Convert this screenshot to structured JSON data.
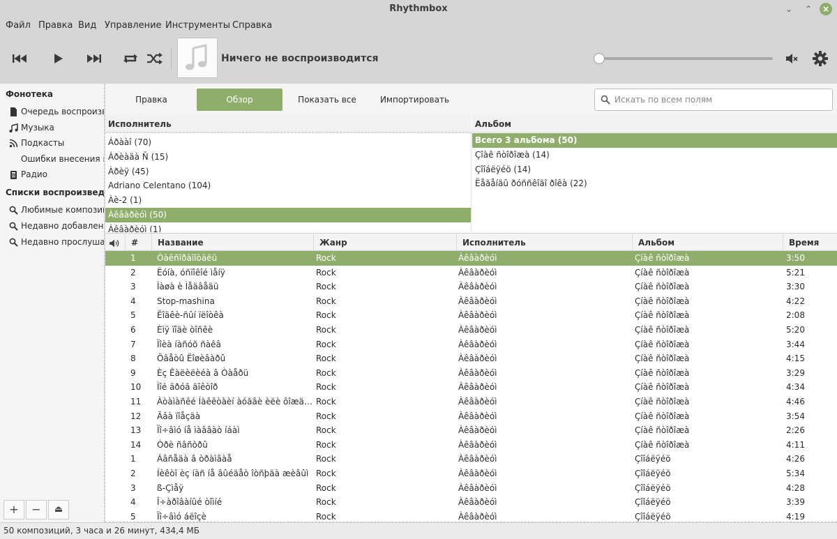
{
  "window": {
    "title": "Rhythmbox"
  },
  "menu": [
    "Файл",
    "Правка",
    "Вид",
    "Управление",
    "Инструменты",
    "Справка"
  ],
  "player": {
    "now_playing": "Ничего не воспроизводится",
    "seek_position": 0
  },
  "sidebar": {
    "library_header": "Фонотека",
    "library_items": [
      {
        "label": "Очередь воспроизведения",
        "icon": "document-icon"
      },
      {
        "label": "Музыка",
        "icon": "music-note-icon"
      },
      {
        "label": "Подкасты",
        "icon": "rss-icon"
      },
      {
        "label": "Ошибки внесения в фонотеку",
        "icon": ""
      },
      {
        "label": "Радио",
        "icon": "radio-icon"
      }
    ],
    "playlists_header": "Списки воспроизведения",
    "playlist_items": [
      {
        "label": "Любимые композиции",
        "icon": "search-icon"
      },
      {
        "label": "Недавно добавленные",
        "icon": "search-icon"
      },
      {
        "label": "Недавно прослушанные",
        "icon": "search-icon"
      }
    ],
    "footer_buttons": [
      "+",
      "−",
      "⏏"
    ]
  },
  "modebar": {
    "buttons": [
      {
        "label": "Правка",
        "active": false
      },
      {
        "label": "Обзор",
        "active": true
      },
      {
        "label": "Показать все",
        "active": false
      },
      {
        "label": "Импортировать",
        "active": false
      }
    ],
    "search_placeholder": "Искать по всем полям"
  },
  "browser": {
    "artist_header": "Исполнитель",
    "album_header": "Альбом",
    "artists": [
      {
        "label": "Áðààî (70)",
        "selected": false
      },
      {
        "label": "Áðèàäà Ñ (15)",
        "selected": false
      },
      {
        "label": "Àðèÿ (45)",
        "selected": false
      },
      {
        "label": "Adriano Celentano (104)",
        "selected": false
      },
      {
        "label": "Àè-2 (1)",
        "selected": false
      },
      {
        "label": "Àêâàðèóì (50)",
        "selected": true
      },
      {
        "label": "Àêâàðèóì (1)",
        "selected": false
      }
    ],
    "albums": [
      {
        "label": "Всего 3 альбома (50)",
        "selected": true
      },
      {
        "label": "Çîàê ñòîðîæà (14)",
        "selected": false
      },
      {
        "label": "Çîîáëÿéö (14)",
        "selected": false
      },
      {
        "label": "Ëåãåíäû ðóññêîãî ðîêà (22)",
        "selected": false
      }
    ]
  },
  "tracklist": {
    "columns": [
      "#",
      "Название",
      "Жанр",
      "Исполнитель",
      "Альбом",
      "Время"
    ],
    "rows": [
      {
        "num": "1",
        "title": "Òàêñîðàìîòäëü",
        "genre": "Rock",
        "artist": "Àêâàðèóì",
        "album": "Çíàê ñòîðîæà",
        "time": "3:50",
        "selected": true
      },
      {
        "num": "2",
        "title": "Ëóíà, óñïîêîé ìåíÿ",
        "genre": "Rock",
        "artist": "Àêâàðèóì",
        "album": "Çíàê ñòîðîæà",
        "time": "5:21",
        "selected": false
      },
      {
        "num": "3",
        "title": "Ìàøà è Ìåäâåäü",
        "genre": "Rock",
        "artist": "Àêâàðèóì",
        "album": "Çíàê ñòîðîæà",
        "time": "3:30",
        "selected": false
      },
      {
        "num": "4",
        "title": "Stop-mashina",
        "genre": "Rock",
        "artist": "Àêâàðèóì",
        "album": "Çíàê ñòîðîæà",
        "time": "4:22",
        "selected": false
      },
      {
        "num": "5",
        "title": "Ëîäêè-ñûí ïëîòêà",
        "genre": "Rock",
        "artist": "Àêâàðèóì",
        "album": "Çíàê ñòîðîæà",
        "time": "2:08",
        "selected": false
      },
      {
        "num": "6",
        "title": "Èìÿ ïîäè òîñêè",
        "genre": "Rock",
        "artist": "Àêâàðèóì",
        "album": "Çíàê ñòîðîæà",
        "time": "5:20",
        "selected": false
      },
      {
        "num": "7",
        "title": "Ïîèà íàñóõ ñàêâ",
        "genre": "Rock",
        "artist": "Àêâàðèóì",
        "album": "Çíàê ñòîðîæà",
        "time": "3:44",
        "selected": false
      },
      {
        "num": "8",
        "title": "Öâåòû Ëîøèâàðû",
        "genre": "Rock",
        "artist": "Àêâàðèóì",
        "album": "Çíàê ñòîðîæà",
        "time": "4:15",
        "selected": false
      },
      {
        "num": "9",
        "title": "Èç Êàëèëèéà â Òàåðü",
        "genre": "Rock",
        "artist": "Àêâàðèóì",
        "album": "Çíàê ñòîðîæà",
        "time": "3:29",
        "selected": false
      },
      {
        "num": "10",
        "title": "Ìîé äðóã äîêòîð",
        "genre": "Rock",
        "artist": "Àêâàðèóì",
        "album": "Çíàê ñòîðîæà",
        "time": "4:34",
        "selected": false
      },
      {
        "num": "11",
        "title": "Àòàìàñêé Íàêêòàèí àóãâè èëè ôîæäâíèâ ç…",
        "genre": "Rock",
        "artist": "Àêâàðèóì",
        "album": "Çíàê ñòîðîæà",
        "time": "4:46",
        "selected": false
      },
      {
        "num": "12",
        "title": "Äâà ïîåçäà",
        "genre": "Rock",
        "artist": "Àêâàðèóì",
        "album": "Çíàê ñòîðîæà",
        "time": "3:54",
        "selected": false
      },
      {
        "num": "13",
        "title": "Ïî÷âìó íå ìàââàò íáàì",
        "genre": "Rock",
        "artist": "Àêâàðèóì",
        "album": "Çíàê ñòîðîæà",
        "time": "2:26",
        "selected": false
      },
      {
        "num": "14",
        "title": "Òðè ñâñòðû",
        "genre": "Rock",
        "artist": "Àêâàðèóì",
        "album": "Çíàê ñòîðîæà",
        "time": "4:11",
        "selected": false
      },
      {
        "num": "1",
        "title": "Áâñåäà â òðàìâàå",
        "genre": "Rock",
        "artist": "Àêâàðèóì",
        "album": "Çîîáëÿéö",
        "time": "4:26",
        "selected": false
      },
      {
        "num": "2",
        "title": "Íèêòî èç íàñ íå âûéäåò îòñþäà æèâûì",
        "genre": "Rock",
        "artist": "Àêâàðèóì",
        "album": "Çîîáëÿéö",
        "time": "5:34",
        "selected": false
      },
      {
        "num": "3",
        "title": "ß-Çìåÿ",
        "genre": "Rock",
        "artist": "Àêâàðèóì",
        "album": "Çîîáëÿéö",
        "time": "4:28",
        "selected": false
      },
      {
        "num": "4",
        "title": "Î÷àðîâàíûé òîìíé",
        "genre": "Rock",
        "artist": "Àêâàðèóì",
        "album": "Çîîáëÿéö",
        "time": "3:39",
        "selected": false
      },
      {
        "num": "5",
        "title": "Ïî÷âìó áëîçè",
        "genre": "Rock",
        "artist": "Àêâàðèóì",
        "album": "Çîîáëÿéö",
        "time": "4:19",
        "selected": false
      }
    ]
  },
  "status": {
    "text": "50 композиций, 3 часа и 26 минут, 434,4 МБ"
  },
  "colors": {
    "accent": "#8fae6b",
    "chrome": "#d6d6d6"
  }
}
